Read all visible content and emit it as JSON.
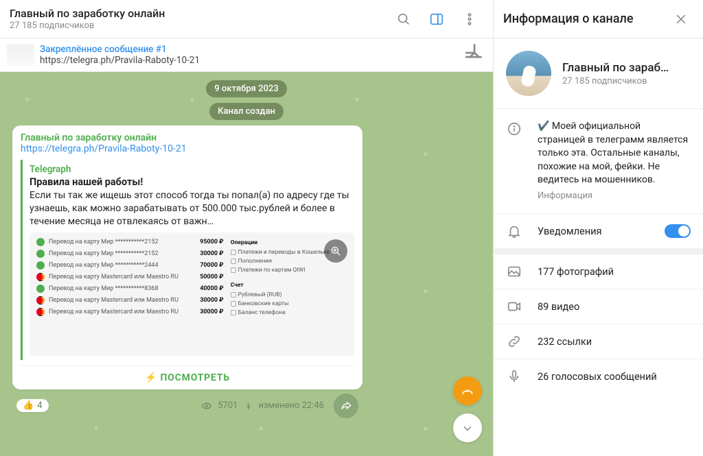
{
  "header": {
    "title": "Главный по заработку онлайн",
    "subscribers": "27 185 подписчиков"
  },
  "pinned": {
    "title": "Закреплённое сообщение #1",
    "text": "https://telegra.ph/Pravila-Raboty-10-21"
  },
  "chat": {
    "date_label": "9 октября 2023",
    "service_label": "Канал создан",
    "message": {
      "author": "Главный по заработку онлайн",
      "link": "https://telegra.ph/Pravila-Raboty-10-21",
      "preview_site": "Telegraph",
      "preview_title": "Правила нашей работы!",
      "preview_desc": "Если ты так же ищешь этот способ тогда ты попал(а) по адресу где ты узнаешь, как можно зарабатывать от 500.000 тыс.рублей и более в течение месяца не отвлекаясь от важн…",
      "view_button": "⚡ ПОСМОТРЕТЬ",
      "reaction_emoji": "👍",
      "reaction_count": "4",
      "views": "5701",
      "edited_time": "изменено 22:46",
      "txns": [
        {
          "label": "Перевод на карту Мир ***********2152",
          "amt": "95000 ₽",
          "mc": false
        },
        {
          "label": "Перевод на карту Мир ***********2152",
          "amt": "30000 ₽",
          "mc": false
        },
        {
          "label": "Перевод на карту Мир ***********2444",
          "amt": "70000 ₽",
          "mc": false
        },
        {
          "label": "Перевод на карту Mastercard или Maestro RU",
          "amt": "50000 ₽",
          "mc": true
        },
        {
          "label": "Перевод на карту Мир ***********8368",
          "amt": "40000 ₽",
          "mc": false
        },
        {
          "label": "Перевод на карту Mastercard или Maestro RU",
          "amt": "30000 ₽",
          "mc": true
        },
        {
          "label": "Перевод на карту Mastercard или Maestro RU",
          "amt": "30000 ₽",
          "mc": true
        }
      ],
      "ops_title": "Операции",
      "ops": [
        "Платежи и переводы в Кошельке",
        "Пополнения",
        "Платежи по картам QIWI"
      ],
      "acct_title": "Счет",
      "accts": [
        "Рублевый (RUB)",
        "Банковские карты",
        "Баланс телефона"
      ]
    }
  },
  "side": {
    "header": "Информация о канале",
    "name": "Главный по зараб…",
    "subscribers": "27 185 подписчиков",
    "about_text": "✔️ Моей официальной страницей в телеграмм является только эта. Остальные каналы, похожие на мой, фейки. Не ведитесь на мошенников.",
    "about_meta": "Информация",
    "notifications_label": "Уведомления",
    "media": {
      "photos": "177 фотографий",
      "videos": "89 видео",
      "links": "232 ссылки",
      "voice": "26 голосовых сообщений"
    }
  }
}
